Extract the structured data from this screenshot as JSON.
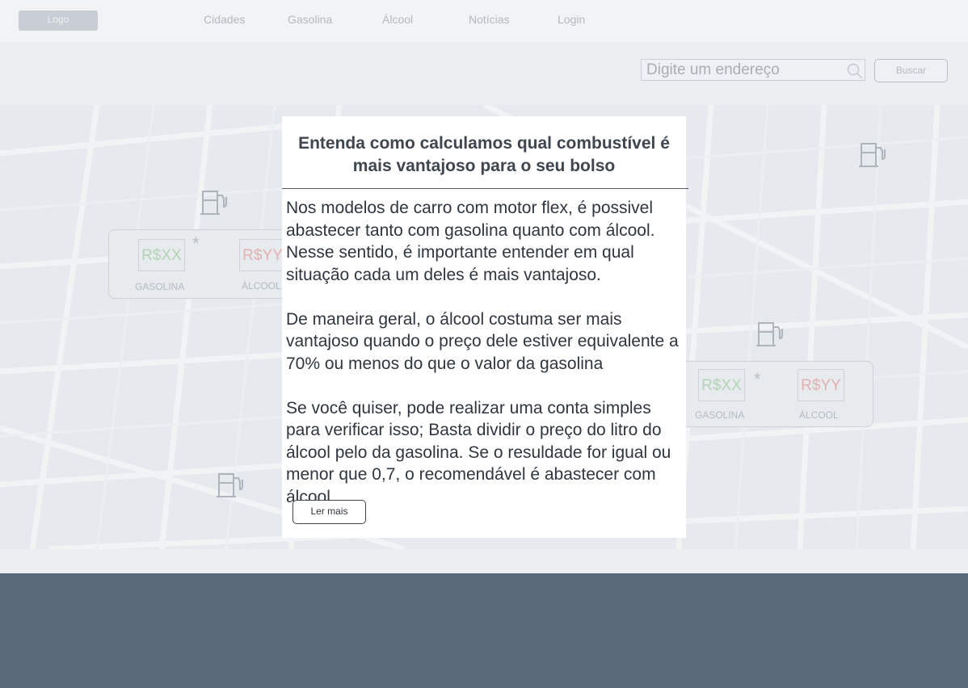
{
  "header": {
    "logo_label": "Logo",
    "nav": [
      "Cidades",
      "Gasolina",
      "Álcool",
      "Notícias",
      "Login"
    ]
  },
  "search": {
    "placeholder": "Digite um endereço",
    "button_label": "Buscar"
  },
  "map": {
    "cards": [
      {
        "gasoline_price": "R$XX",
        "alcohol_price": "R$YY",
        "gasoline_label": "GASOLINA",
        "alcohol_label": "ÁLCOOL",
        "asterisk": "*"
      },
      {
        "gasoline_price": "R$XX",
        "alcohol_price": "R$YY",
        "gasoline_label": "GASOLINA",
        "alcohol_label": "ÁLCOOL",
        "asterisk": "*"
      }
    ],
    "icons": [
      "fuel-pump-icon"
    ]
  },
  "modal": {
    "title": "Entenda como calculamos qual combustível é mais vantajoso para o seu bolso",
    "paragraphs": [
      "Nos modelos de carro com motor flex, é possivel abastecer tanto com gasolina quanto com álcool. Nesse sentido, é importante entender em qual situação cada um deles é mais vantajoso.",
      "De maneira geral, o álcool costuma ser mais vantajoso quando o preço dele estiver equivalente a 70% ou menos do que o valor da gasolina",
      "Se você quiser, pode realizar uma conta simples para verificar isso; Basta dividir o preço do litro do álcool pelo da gasolina. Se o resuldade for igual ou menor que 0,7, o recomendável é abastecer com álcool."
    ],
    "read_more_label": "Ler mais"
  },
  "colors": {
    "footer": "#5b6a78",
    "modal_bg": "#ffffff",
    "gasoline_price": "#b3d3b6",
    "alcohol_price": "#e2b0b3"
  }
}
